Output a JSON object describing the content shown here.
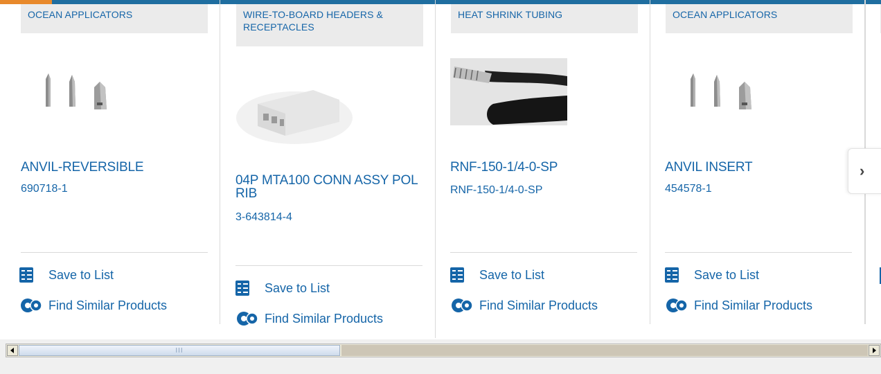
{
  "carousel": {
    "cards": [
      {
        "category": "OCEAN APPLICATORS",
        "title": "ANVIL-REVERSIBLE",
        "part_number": "690718-1",
        "save_label": "Save to List",
        "similar_label": "Find Similar Products"
      },
      {
        "category": "WIRE-TO-BOARD HEADERS & RECEPTACLES",
        "title": "04P MTA100 CONN ASSY POL RIB",
        "part_number": "3-643814-4",
        "save_label": "Save to List",
        "similar_label": "Find Similar Products"
      },
      {
        "category": "HEAT SHRINK TUBING",
        "title": "RNF-150-1/4-0-SP",
        "part_number": "RNF-150-1/4-0-SP",
        "save_label": "Save to List",
        "similar_label": "Find Similar Products"
      },
      {
        "category": "OCEAN APPLICATORS",
        "title": "ANVIL INSERT",
        "part_number": "454578-1",
        "save_label": "Save to List",
        "similar_label": "Find Similar Products"
      }
    ],
    "next_icon": "chevron-right-icon",
    "colors": {
      "link": "#1565a8",
      "category_bg": "#ebebeb",
      "top_bar": "#1f6ea0",
      "top_bar_accent": "#e8892b"
    }
  },
  "scrollbar": {
    "thumb_grip": "III"
  }
}
